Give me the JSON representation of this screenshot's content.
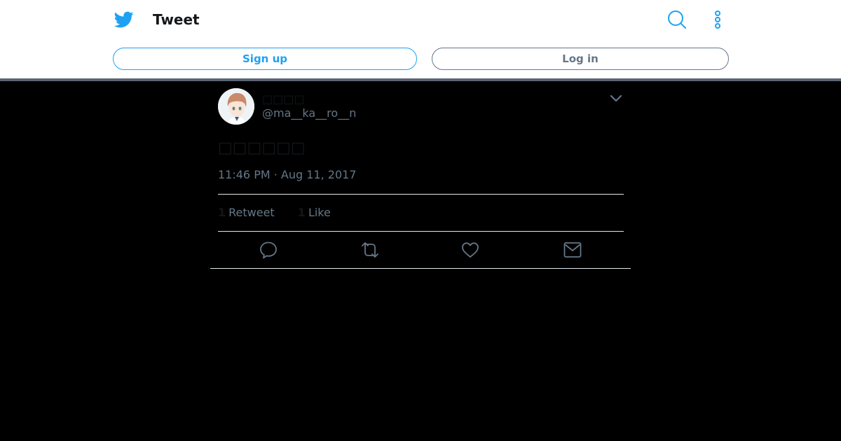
{
  "header": {
    "title": "Tweet",
    "logo_icon": "twitter-bird-icon",
    "search_icon": "search-icon",
    "more_icon": "more-vertical-icon",
    "accent_color": "#1da1f2"
  },
  "auth": {
    "signup_label": "Sign up",
    "login_label": "Log in"
  },
  "tweet": {
    "display_name": "□□□□",
    "handle": "@ma__ka__ro__n",
    "text": "□□□□□□",
    "timestamp": "11:46 PM · Aug 11, 2017",
    "retweet_count": "1",
    "retweet_label": "Retweet",
    "like_count": "1",
    "like_label": "Like",
    "caret_icon": "chevron-down-icon"
  },
  "actions": {
    "reply_icon": "reply-icon",
    "retweet_icon": "retweet-icon",
    "like_icon": "heart-icon",
    "dm_icon": "envelope-icon"
  }
}
